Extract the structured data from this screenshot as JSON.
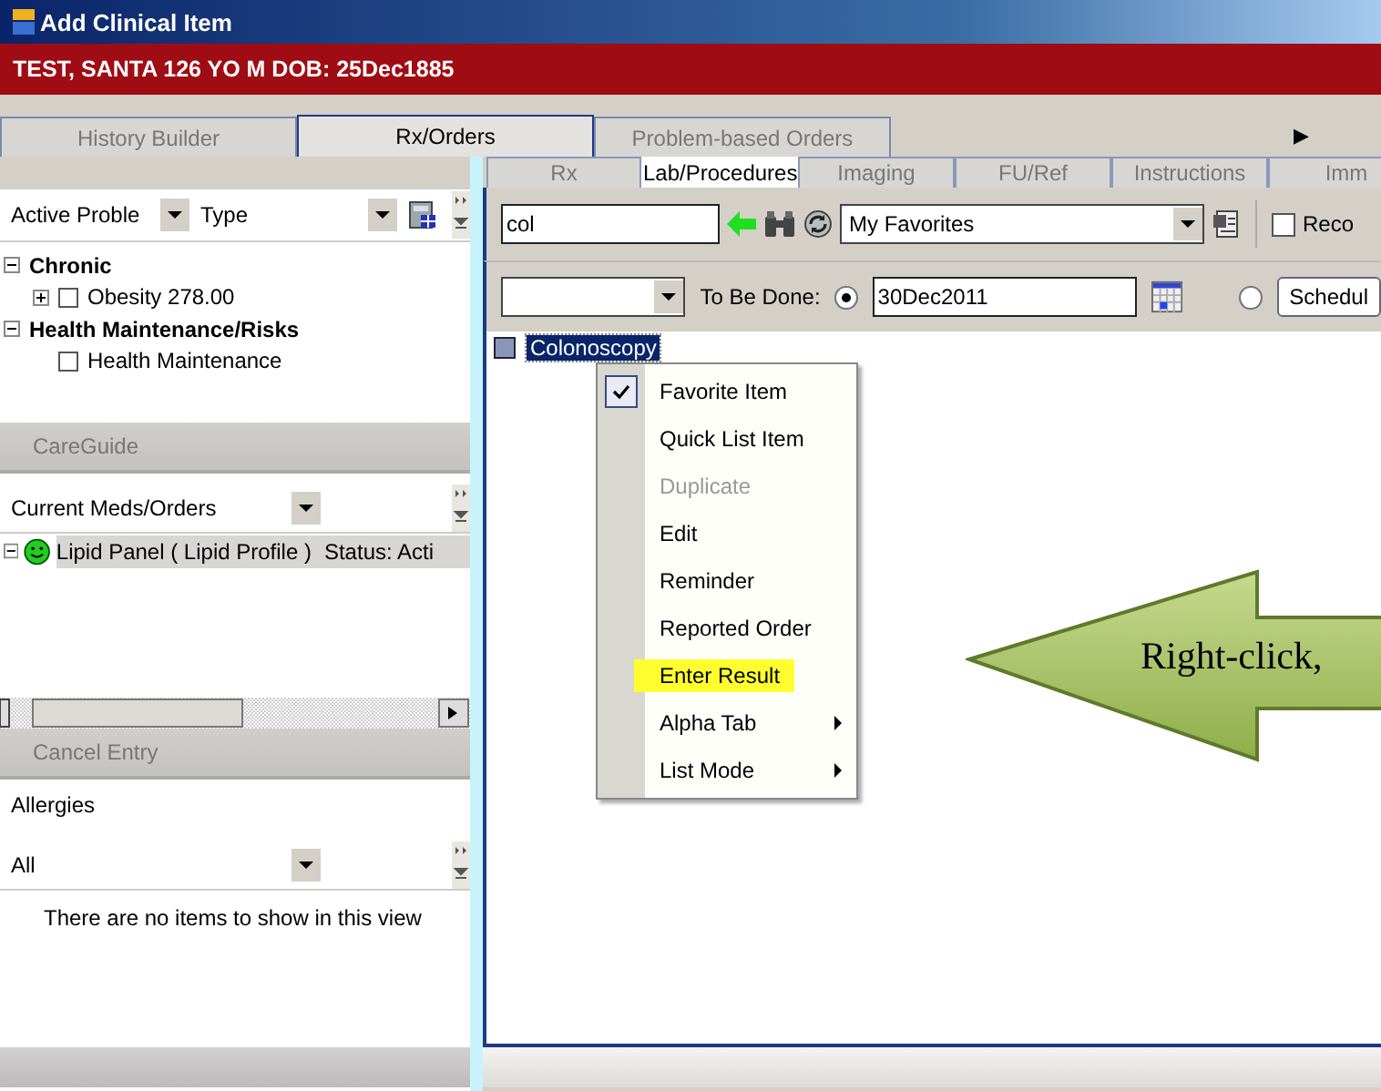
{
  "window": {
    "title": "Add Clinical Item"
  },
  "patient_banner": "TEST, SANTA  126 YO  M DOB: 25Dec1885",
  "main_tabs": [
    {
      "label": "History Builder",
      "selected": false
    },
    {
      "label": "Rx/Orders",
      "selected": true
    },
    {
      "label": "Problem-based Orders",
      "selected": false
    }
  ],
  "tabs_scroll": "▶",
  "problems": {
    "filter": "Active Proble",
    "type": "Type",
    "tree": [
      {
        "label": "Chronic",
        "expanded": true,
        "children": [
          {
            "label": "Obesity 278.00",
            "expanded": false,
            "checked": false
          }
        ]
      },
      {
        "label": "Health Maintenance/Risks",
        "expanded": true,
        "children": [
          {
            "label": "Health Maintenance",
            "checked": false
          }
        ]
      }
    ]
  },
  "careguide": {
    "header": "CareGuide",
    "filter": "Current Meds/Orders",
    "items": [
      {
        "name": "Lipid Panel ( Lipid Profile )",
        "status": "Status: Acti",
        "expanded": true
      }
    ]
  },
  "cancel_entry": {
    "header": "Cancel Entry"
  },
  "allergies": {
    "label": "Allergies",
    "filter": "All",
    "empty_message": "There are no items to show in this view"
  },
  "sub_tabs": [
    {
      "label": "Rx",
      "selected": false
    },
    {
      "label": "Lab/Procedures",
      "selected": true
    },
    {
      "label": "Imaging",
      "selected": false
    },
    {
      "label": "FU/Ref",
      "selected": false
    },
    {
      "label": "Instructions",
      "selected": false
    },
    {
      "label": "Imm",
      "selected": false
    }
  ],
  "search": {
    "value": "col",
    "list": "My Favorites",
    "checkbox_label": "Reco",
    "checked": false
  },
  "schedule": {
    "to_be_done_label": "To Be Done:",
    "date_selected": true,
    "date": "30Dec2011",
    "schedule_selected": false,
    "schedule_button": "Schedul"
  },
  "results": [
    {
      "label": "Colonoscopy",
      "selected": true,
      "checked": false
    }
  ],
  "context_menu": [
    {
      "label": "Favorite Item",
      "checked": true,
      "disabled": false,
      "highlighted": false,
      "submenu": false
    },
    {
      "label": "Quick List Item",
      "checked": false,
      "disabled": false,
      "highlighted": false,
      "submenu": false
    },
    {
      "label": "Duplicate",
      "checked": false,
      "disabled": true,
      "highlighted": false,
      "submenu": false
    },
    {
      "label": "Edit",
      "checked": false,
      "disabled": false,
      "highlighted": false,
      "submenu": false
    },
    {
      "label": "Reminder",
      "checked": false,
      "disabled": false,
      "highlighted": false,
      "submenu": false
    },
    {
      "label": "Reported Order",
      "checked": false,
      "disabled": false,
      "highlighted": false,
      "submenu": false
    },
    {
      "label": "Enter Result",
      "checked": false,
      "disabled": false,
      "highlighted": true,
      "submenu": false
    },
    {
      "label": "Alpha Tab",
      "checked": false,
      "disabled": false,
      "highlighted": false,
      "submenu": true
    },
    {
      "label": "List Mode",
      "checked": false,
      "disabled": false,
      "highlighted": false,
      "submenu": true
    }
  ],
  "callout": "Right-click,"
}
